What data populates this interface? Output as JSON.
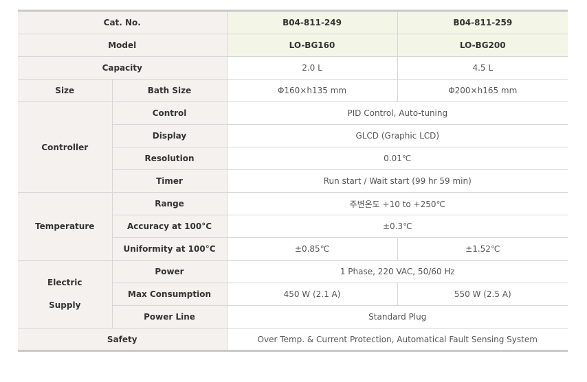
{
  "header": {
    "cat_no_label": "Cat. No.",
    "cat_no": [
      "B04-811-249",
      "B04-811-259"
    ],
    "model_label": "Model",
    "model": [
      "LO-BG160",
      "LO-BG200"
    ]
  },
  "capacity": {
    "label": "Capacity",
    "values": [
      "2.0 L",
      "4.5 L"
    ]
  },
  "size": {
    "label": "Size",
    "bath_size_label": "Bath Size",
    "bath_size": [
      "Φ160×h135 mm",
      "Φ200×h165 mm"
    ]
  },
  "controller": {
    "label": "Controller",
    "control_label": "Control",
    "control": "PID Control, Auto-tuning",
    "display_label": "Display",
    "display": "GLCD (Graphic LCD)",
    "resolution_label": "Resolution",
    "resolution": "0.01℃",
    "timer_label": "Timer",
    "timer": "Run start / Wait start (99 hr 59 min)"
  },
  "temperature": {
    "label": "Temperature",
    "range_label": "Range",
    "range": "주변온도 +10 to +250℃",
    "accuracy_label": "Accuracy at 100°C",
    "accuracy": "±0.3℃",
    "uniformity_label": "Uniformity at 100°C",
    "uniformity": [
      "±0.85℃",
      "±1.52℃"
    ]
  },
  "electric": {
    "label_line1": "Electric",
    "label_line2": "Supply",
    "power_label": "Power",
    "power": "1 Phase, 220 VAC, 50/60 Hz",
    "max_consumption_label": "Max Consumption",
    "max_consumption": [
      "450 W (2.1 A)",
      "550 W (2.5 A)"
    ],
    "power_line_label": "Power Line",
    "power_line": "Standard Plug"
  },
  "safety": {
    "label": "Safety",
    "value": "Over Temp. & Current Protection, Automatical Fault Sensing System"
  }
}
